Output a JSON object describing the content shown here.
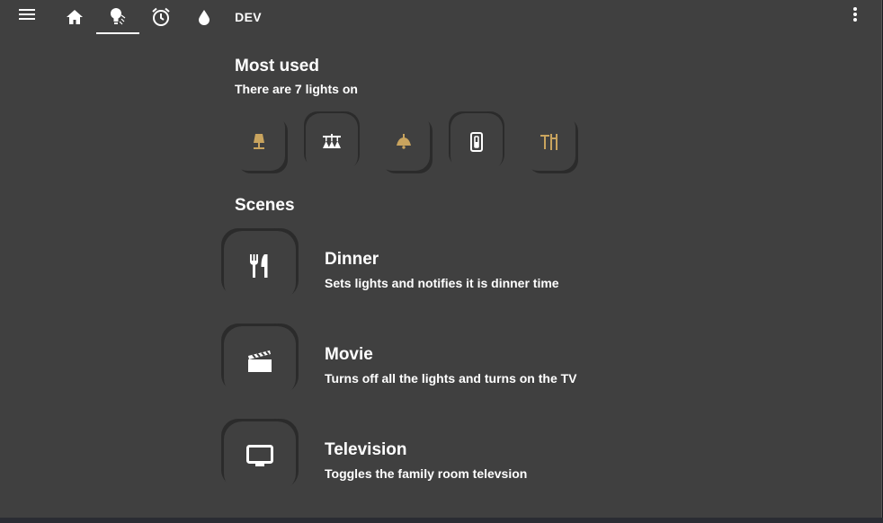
{
  "colors": {
    "background": "#404040",
    "accent_light": "#c9a45e",
    "icon": "#ffffff"
  },
  "topbar": {
    "menu_icon": "hamburger-menu-icon",
    "tabs": [
      {
        "icon": "home-icon"
      },
      {
        "icon": "lightbulb-icon",
        "active": true
      },
      {
        "icon": "alarm-clock-icon"
      },
      {
        "icon": "water-drop-icon"
      }
    ],
    "dev_label": "DEV",
    "overflow_icon": "more-vertical-icon"
  },
  "most_used": {
    "title": "Most used",
    "subtitle": "There are 7 lights on",
    "lights": [
      {
        "icon": "table-lamp-icon"
      },
      {
        "icon": "chandelier-icon"
      },
      {
        "icon": "pendant-lamp-icon"
      },
      {
        "icon": "wall-switch-icon"
      },
      {
        "icon": "desk-lamp-icon"
      }
    ]
  },
  "scenes": {
    "title": "Scenes",
    "items": [
      {
        "icon": "silverware-icon",
        "title": "Dinner",
        "description": "Sets lights and notifies it is dinner time"
      },
      {
        "icon": "clapperboard-icon",
        "title": "Movie",
        "description": "Turns off all the lights and turns on the TV"
      },
      {
        "icon": "television-icon",
        "title": "Television",
        "description": "Toggles the family room televsion"
      }
    ]
  }
}
